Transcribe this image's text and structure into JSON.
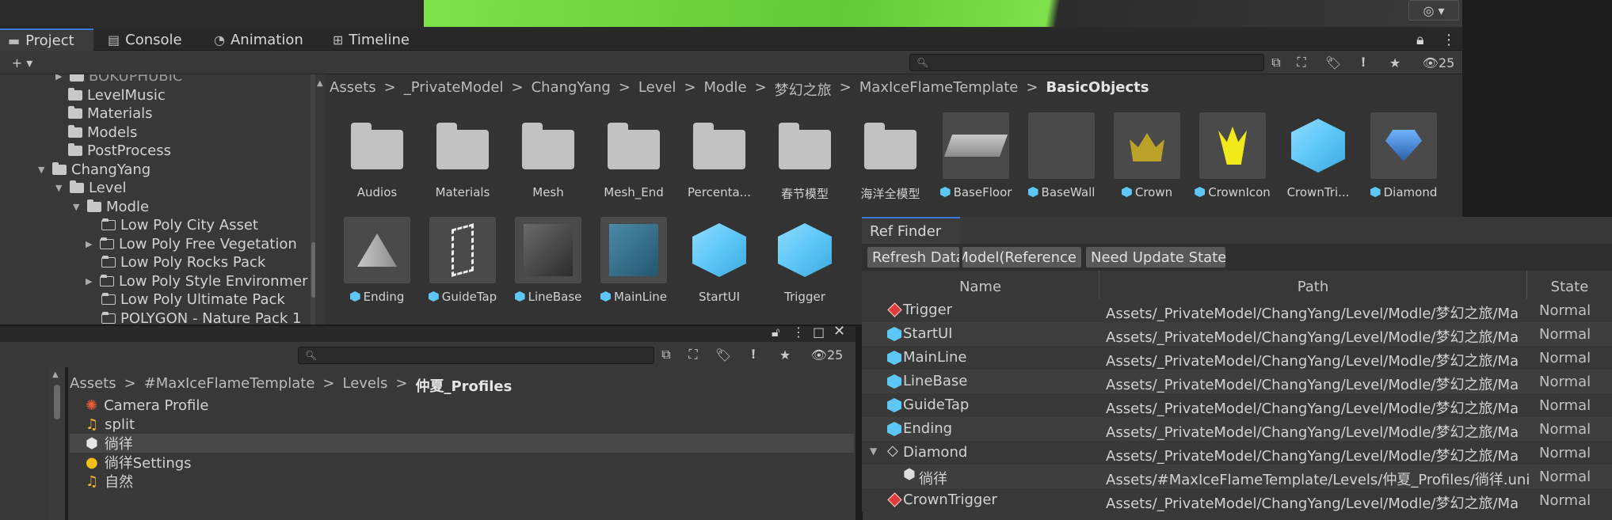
{
  "tabs": [
    {
      "label": "Project",
      "icon": "folder-icon"
    },
    {
      "label": "Console",
      "icon": "console-icon"
    },
    {
      "label": "Animation",
      "icon": "animation-icon"
    },
    {
      "label": "Timeline",
      "icon": "timeline-icon"
    }
  ],
  "toolbar": {
    "add_label": "+ ▾",
    "visible_count": "25"
  },
  "tree": {
    "items": [
      {
        "label": "LevelMusic",
        "indent": 1,
        "icon": "folder"
      },
      {
        "label": "Materials",
        "indent": 1,
        "icon": "folder"
      },
      {
        "label": "Models",
        "indent": 1,
        "icon": "folder"
      },
      {
        "label": "PostProcess",
        "indent": 1,
        "icon": "folder"
      },
      {
        "label": "ChangYang",
        "indent": 0,
        "icon": "folder-open",
        "arrow": "▼"
      },
      {
        "label": "Level",
        "indent": 1,
        "icon": "folder-open",
        "arrow": "▼"
      },
      {
        "label": "Modle",
        "indent": 2,
        "icon": "folder-open",
        "arrow": "▼"
      },
      {
        "label": "Low Poly City Asset",
        "indent": 3,
        "icon": "folder-outline"
      },
      {
        "label": "Low Poly Free Vegetation",
        "indent": 3,
        "icon": "folder-outline",
        "arrow": "▶"
      },
      {
        "label": "Low Poly Rocks Pack",
        "indent": 3,
        "icon": "folder-outline"
      },
      {
        "label": "Low Poly Style Environmer",
        "indent": 3,
        "icon": "folder-outline",
        "arrow": "▶"
      },
      {
        "label": "Low Poly Ultimate Pack",
        "indent": 3,
        "icon": "folder-outline"
      },
      {
        "label": "POLYGON - Nature Pack 1",
        "indent": 3,
        "icon": "folder-outline"
      }
    ],
    "cut_top": "BOKUPHUBIC"
  },
  "breadcrumb": {
    "items": [
      "Assets",
      ">",
      "_PrivateModel",
      ">",
      "ChangYang",
      ">",
      "Level",
      ">",
      "Modle",
      ">",
      "梦幻之旅",
      ">",
      "MaxIceFlameTemplate",
      ">"
    ],
    "current": "BasicObjects"
  },
  "assets_row1": [
    {
      "label": "Audios",
      "kind": "folder"
    },
    {
      "label": "Materials",
      "kind": "folder"
    },
    {
      "label": "Mesh",
      "kind": "folder"
    },
    {
      "label": "Mesh_End",
      "kind": "folder"
    },
    {
      "label": "Percenta...",
      "kind": "folder"
    },
    {
      "label": "春节模型",
      "kind": "folder"
    },
    {
      "label": "海洋全模型",
      "kind": "folder"
    },
    {
      "label": "BaseFloor",
      "kind": "prefab-floor"
    },
    {
      "label": "BaseWall",
      "kind": "prefab-wall"
    },
    {
      "label": "Crown",
      "kind": "prefab-crown"
    },
    {
      "label": "CrownIcon",
      "kind": "prefab-crownicon"
    },
    {
      "label": "CrownTri...",
      "kind": "cube"
    },
    {
      "label": "Diamond",
      "kind": "prefab-diamond"
    }
  ],
  "assets_row2": [
    {
      "label": "Ending",
      "kind": "prefab-pyramid"
    },
    {
      "label": "GuideTap",
      "kind": "prefab-guidetap"
    },
    {
      "label": "LineBase",
      "kind": "prefab-linebase"
    },
    {
      "label": "MainLine",
      "kind": "prefab-mainline"
    },
    {
      "label": "StartUI",
      "kind": "cube"
    },
    {
      "label": "Trigger",
      "kind": "cube"
    }
  ],
  "lower": {
    "visible_count": "25",
    "breadcrumb": [
      "Assets",
      ">",
      "#MaxIceFlameTemplate",
      ">",
      "Levels",
      ">"
    ],
    "breadcrumb_current": "仲夏_Profiles",
    "items": [
      {
        "label": "Camera Profile",
        "icon": "camera-profile-icon"
      },
      {
        "label": "split",
        "icon": "audio-icon"
      },
      {
        "label": "徜徉",
        "icon": "unity-scene-icon",
        "selected": true
      },
      {
        "label": "徜徉Settings",
        "icon": "lighting-settings-icon"
      },
      {
        "label": "自然",
        "icon": "audio-icon"
      }
    ]
  },
  "ref_finder": {
    "title": "Ref Finder",
    "buttons": [
      "Refresh Data",
      "Model(Reference",
      "Need Update State"
    ],
    "columns": [
      "Name",
      "Path",
      "State"
    ],
    "rows": [
      {
        "name": "Trigger",
        "path": "Assets/_PrivateModel/ChangYang/Level/Modle/梦幻之旅/Ma",
        "state": "Normal",
        "icon": "diamond-red"
      },
      {
        "name": "StartUI",
        "path": "Assets/_PrivateModel/ChangYang/Level/Modle/梦幻之旅/Ma",
        "state": "Normal",
        "icon": "cube"
      },
      {
        "name": "MainLine",
        "path": "Assets/_PrivateModel/ChangYang/Level/Modle/梦幻之旅/Ma",
        "state": "Normal",
        "icon": "cube"
      },
      {
        "name": "LineBase",
        "path": "Assets/_PrivateModel/ChangYang/Level/Modle/梦幻之旅/Ma",
        "state": "Normal",
        "icon": "cube"
      },
      {
        "name": "GuideTap",
        "path": "Assets/_PrivateModel/ChangYang/Level/Modle/梦幻之旅/Ma",
        "state": "Normal",
        "icon": "cube"
      },
      {
        "name": "Ending",
        "path": "Assets/_PrivateModel/ChangYang/Level/Modle/梦幻之旅/Ma",
        "state": "Normal",
        "icon": "cube"
      },
      {
        "name": "Diamond",
        "path": "Assets/_PrivateModel/ChangYang/Level/Modle/梦幻之旅/Ma",
        "state": "Normal",
        "icon": "diamond-outline",
        "arrow": "▼"
      },
      {
        "name": "徜徉",
        "path": "Assets/#MaxIceFlameTemplate/Levels/仲夏_Profiles/徜徉.uni",
        "state": "Normal",
        "icon": "unity",
        "child": true
      },
      {
        "name": "CrownTrigger",
        "path": "Assets/_PrivateModel/ChangYang/Level/Modle/梦幻之旅/Ma",
        "state": "Normal",
        "icon": "diamond-red"
      }
    ]
  }
}
